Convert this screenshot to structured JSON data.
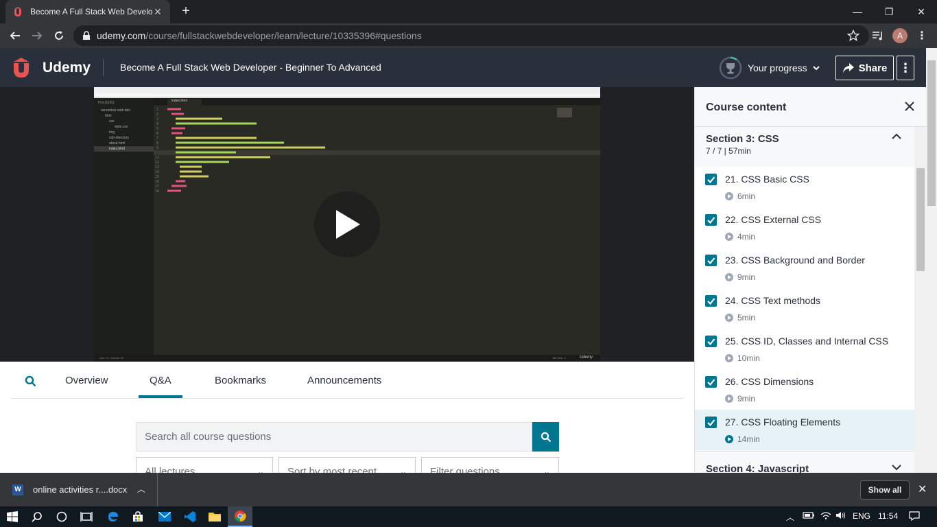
{
  "browser": {
    "tab_title": "Become A Full Stack Web Develo",
    "url_host": "udemy.com",
    "url_path": "/course/fullstackwebdeveloper/learn/lecture/10335396#questions",
    "profile_initial": "A"
  },
  "header": {
    "logo_text": "Udemy",
    "course_title": "Become A Full Stack Web Developer - Beginner To Advanced",
    "progress_label": "Your progress",
    "share_label": "Share",
    "more_label": "⋮"
  },
  "editor": {
    "file_tab": "index.html",
    "folders_label": "FOLDERS",
    "tree": [
      "serverless web dev",
      "html",
      "css",
      "style.css",
      "img",
      "sub-directory",
      "about.html",
      "index.html"
    ],
    "status_left": "Line 10, Column 26",
    "status_right": "Tab Size: 2",
    "watermark": "Udemy"
  },
  "tabs": {
    "overview": "Overview",
    "qa": "Q&A",
    "bookmarks": "Bookmarks",
    "announcements": "Announcements"
  },
  "qa": {
    "search_placeholder": "Search all course questions",
    "filter_lectures": "All lectures",
    "filter_sort": "Sort by most recent",
    "filter_questions": "Filter questions"
  },
  "sidebar": {
    "title": "Course content",
    "section_title": "Section 3: CSS",
    "section_meta": "7 / 7 | 57min",
    "lessons": [
      {
        "title": "21. CSS Basic CSS",
        "duration": "6min"
      },
      {
        "title": "22. CSS External CSS",
        "duration": "4min"
      },
      {
        "title": "23. CSS Background and Border",
        "duration": "9min"
      },
      {
        "title": "24. CSS Text methods",
        "duration": "5min"
      },
      {
        "title": "25. CSS ID, Classes and Internal CSS",
        "duration": "10min"
      },
      {
        "title": "26. CSS Dimensions",
        "duration": "9min"
      },
      {
        "title": "27. CSS Floating Elements",
        "duration": "14min"
      }
    ],
    "next_section_title": "Section 4: Javascript"
  },
  "downloads": {
    "file_name": "online activities r....docx",
    "show_all": "Show all"
  },
  "taskbar": {
    "language": "ENG",
    "time": "11:54"
  },
  "colors": {
    "accent": "#007791",
    "header_bg": "#29303b",
    "udemy_red": "#ec5252"
  }
}
